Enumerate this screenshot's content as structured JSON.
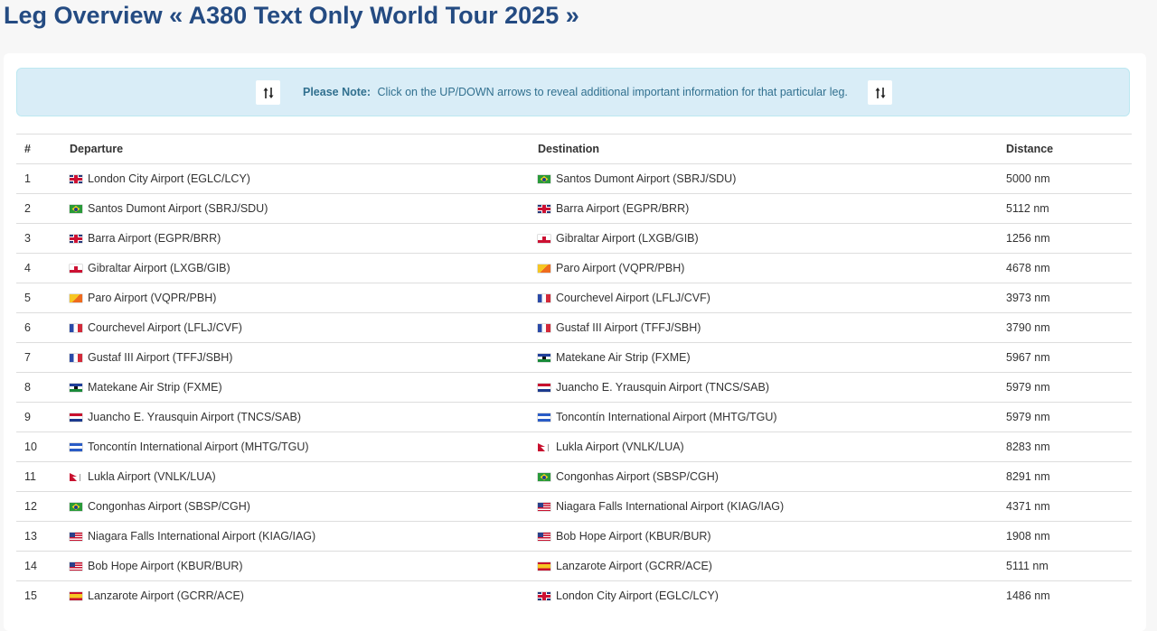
{
  "page": {
    "title": "Leg Overview « A380 Text Only World Tour 2025 »"
  },
  "note": {
    "label": "Please Note:",
    "text": "Click on the UP/DOWN arrows to reveal additional important information for that particular leg."
  },
  "colors": {
    "title": "#244b82",
    "note_bg": "#d9edf7",
    "note_text": "#31708f"
  },
  "table": {
    "headers": [
      "#",
      "Departure",
      "Destination",
      "Distance"
    ],
    "rows": [
      {
        "num": "1",
        "dep": "London City Airport (EGLC/LCY)",
        "dep_flag": "gb",
        "dst": "Santos Dumont Airport (SBRJ/SDU)",
        "dst_flag": "br",
        "dist": "5000 nm"
      },
      {
        "num": "2",
        "dep": "Santos Dumont Airport (SBRJ/SDU)",
        "dep_flag": "br",
        "dst": "Barra Airport (EGPR/BRR)",
        "dst_flag": "gb",
        "dist": "5112 nm"
      },
      {
        "num": "3",
        "dep": "Barra Airport (EGPR/BRR)",
        "dep_flag": "gb",
        "dst": "Gibraltar Airport (LXGB/GIB)",
        "dst_flag": "gi",
        "dist": "1256 nm"
      },
      {
        "num": "4",
        "dep": "Gibraltar Airport (LXGB/GIB)",
        "dep_flag": "gi",
        "dst": "Paro Airport (VQPR/PBH)",
        "dst_flag": "bt",
        "dist": "4678 nm"
      },
      {
        "num": "5",
        "dep": "Paro Airport (VQPR/PBH)",
        "dep_flag": "bt",
        "dst": "Courchevel Airport (LFLJ/CVF)",
        "dst_flag": "fr",
        "dist": "3973 nm"
      },
      {
        "num": "6",
        "dep": "Courchevel Airport (LFLJ/CVF)",
        "dep_flag": "fr",
        "dst": "Gustaf III Airport (TFFJ/SBH)",
        "dst_flag": "fr",
        "dist": "3790 nm"
      },
      {
        "num": "7",
        "dep": "Gustaf III Airport (TFFJ/SBH)",
        "dep_flag": "fr",
        "dst": "Matekane Air Strip (FXME)",
        "dst_flag": "ls",
        "dist": "5967 nm"
      },
      {
        "num": "8",
        "dep": "Matekane Air Strip (FXME)",
        "dep_flag": "ls",
        "dst": "Juancho E. Yrausquin Airport (TNCS/SAB)",
        "dst_flag": "an",
        "dist": "5979 nm"
      },
      {
        "num": "9",
        "dep": "Juancho E. Yrausquin Airport (TNCS/SAB)",
        "dep_flag": "an",
        "dst": "Toncontín International Airport (MHTG/TGU)",
        "dst_flag": "hn",
        "dist": "5979 nm"
      },
      {
        "num": "10",
        "dep": "Toncontín International Airport (MHTG/TGU)",
        "dep_flag": "hn",
        "dst": "Lukla Airport (VNLK/LUA)",
        "dst_flag": "np",
        "dist": "8283 nm"
      },
      {
        "num": "11",
        "dep": "Lukla Airport (VNLK/LUA)",
        "dep_flag": "np",
        "dst": "Congonhas Airport (SBSP/CGH)",
        "dst_flag": "br",
        "dist": "8291 nm"
      },
      {
        "num": "12",
        "dep": "Congonhas Airport (SBSP/CGH)",
        "dep_flag": "br",
        "dst": "Niagara Falls International Airport (KIAG/IAG)",
        "dst_flag": "us",
        "dist": "4371 nm"
      },
      {
        "num": "13",
        "dep": "Niagara Falls International Airport (KIAG/IAG)",
        "dep_flag": "us",
        "dst": "Bob Hope Airport (KBUR/BUR)",
        "dst_flag": "us",
        "dist": "1908 nm"
      },
      {
        "num": "14",
        "dep": "Bob Hope Airport (KBUR/BUR)",
        "dep_flag": "us",
        "dst": "Lanzarote Airport (GCRR/ACE)",
        "dst_flag": "es",
        "dist": "5111 nm"
      },
      {
        "num": "15",
        "dep": "Lanzarote Airport (GCRR/ACE)",
        "dep_flag": "es",
        "dst": "London City Airport (EGLC/LCY)",
        "dst_flag": "gb",
        "dist": "1486 nm"
      }
    ]
  }
}
